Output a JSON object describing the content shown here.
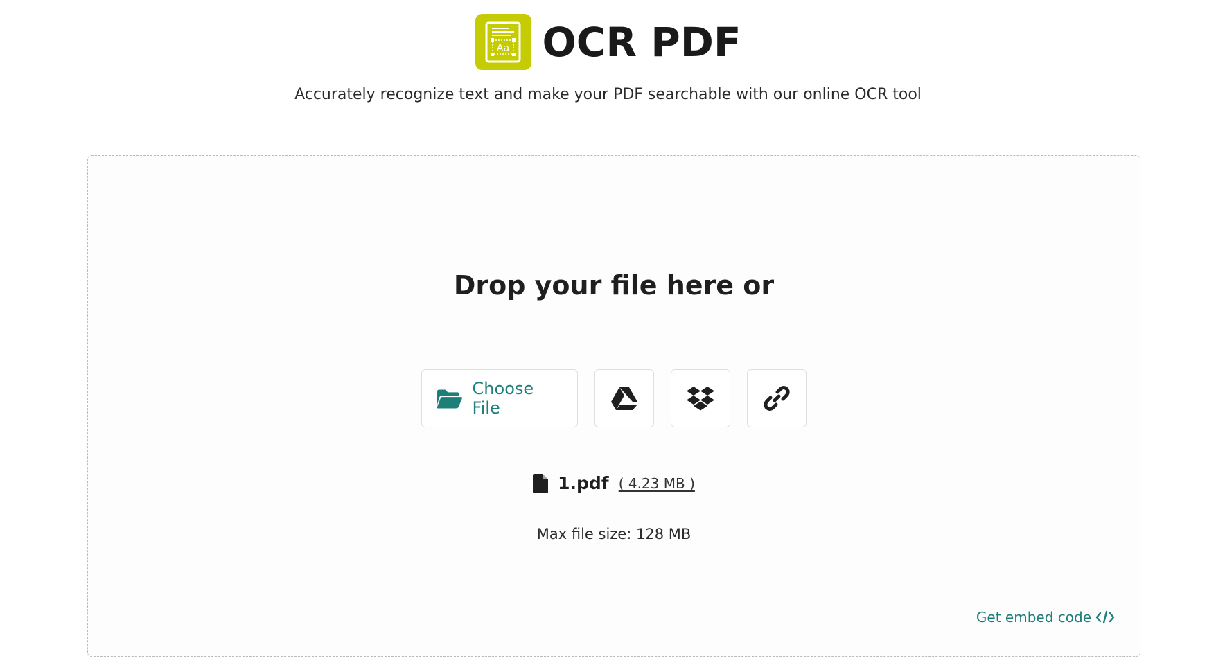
{
  "header": {
    "title": "OCR PDF",
    "subtitle": "Accurately recognize text and make your PDF searchable with our online OCR tool",
    "logo_color": "#c5cc04",
    "logo_icon": "document-text-recognition-icon"
  },
  "dropzone": {
    "heading": "Drop your file here or",
    "choose_file_label": "Choose File",
    "sources": [
      {
        "name": "google-drive",
        "icon": "google-drive-icon"
      },
      {
        "name": "dropbox",
        "icon": "dropbox-icon"
      },
      {
        "name": "url",
        "icon": "link-icon"
      }
    ],
    "file": {
      "name": "1.pdf",
      "size": "( 4.23 MB )",
      "icon": "file-icon"
    },
    "max_file_size": "Max file size: 128 MB",
    "embed_label": "Get embed code",
    "embed_icon": "code-icon"
  },
  "colors": {
    "accent": "#1e7f7a",
    "text": "#1c1c1c",
    "border": "#b9b9b9"
  }
}
